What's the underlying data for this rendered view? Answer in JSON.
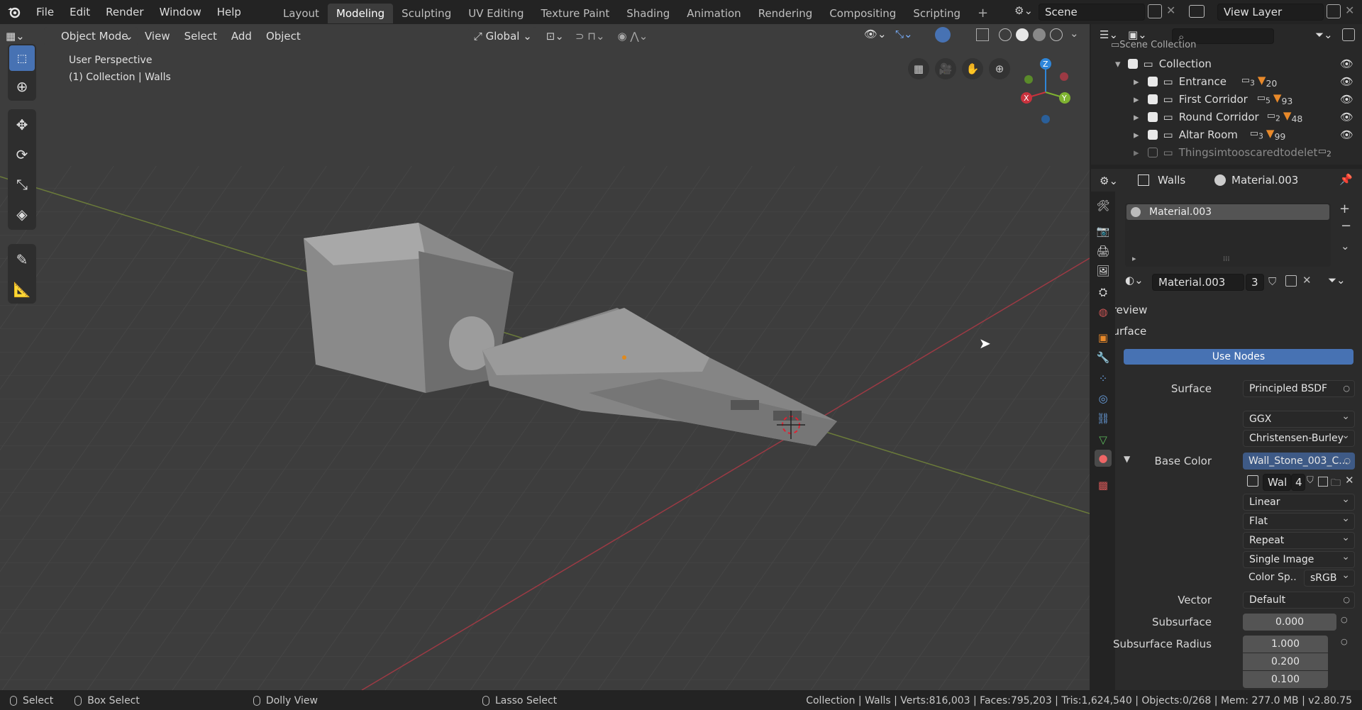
{
  "topbar": {
    "menus": [
      "File",
      "Edit",
      "Render",
      "Window",
      "Help"
    ],
    "workspaces": [
      "Layout",
      "Modeling",
      "Sculpting",
      "UV Editing",
      "Texture Paint",
      "Shading",
      "Animation",
      "Rendering",
      "Compositing",
      "Scripting"
    ],
    "active_workspace": "Modeling",
    "add_tab": "+",
    "scene": "Scene",
    "view_layer": "View Layer"
  },
  "viewport_header": {
    "mode": "Object Mode",
    "menus": [
      "View",
      "Select",
      "Add",
      "Object"
    ],
    "transform_orientation": "Global"
  },
  "viewport": {
    "perspective": "User Perspective",
    "context": "(1) Collection | Walls",
    "gizmo": {
      "x": "X",
      "y": "Y",
      "z": "Z"
    }
  },
  "outliner": {
    "search_placeholder": "",
    "scene_collection": "Scene Collection",
    "collection": "Collection",
    "items": [
      {
        "name": "Entrance",
        "count_a": "3",
        "count_b": "20",
        "enabled": true
      },
      {
        "name": "First Corridor",
        "count_a": "5",
        "count_b": "93",
        "enabled": true
      },
      {
        "name": "Round Corridor",
        "count_a": "2",
        "count_b": "48",
        "enabled": true
      },
      {
        "name": "Altar Room",
        "count_a": "3",
        "count_b": "99",
        "enabled": true
      },
      {
        "name": "Thingsimtooscaredtodelet",
        "count_a": "2",
        "count_b": "",
        "enabled": false
      }
    ]
  },
  "properties": {
    "object": "Walls",
    "material_tab": "Material.003",
    "slot": "Material.003",
    "material_name": "Material.003",
    "users": "3",
    "preview": "Preview",
    "surface_panel": "Surface",
    "use_nodes": "Use Nodes",
    "rows": {
      "surface_label": "Surface",
      "surface_value": "Principled BSDF",
      "distribution": "GGX",
      "subsurface_method": "Christensen-Burley",
      "base_color_label": "Base Color",
      "base_color_value": "Wall_Stone_003_C...",
      "image_name": "Wal",
      "image_users": "4",
      "interpolation": "Linear",
      "projection": "Flat",
      "extension": "Repeat",
      "source": "Single Image",
      "color_space_label": "Color Sp..",
      "color_space_value": "sRGB",
      "vector_label": "Vector",
      "vector_value": "Default",
      "subsurface_label": "Subsurface",
      "subsurface_value": "0.000",
      "radius_label": "Subsurface Radius",
      "radius": [
        "1.000",
        "0.200",
        "0.100"
      ]
    }
  },
  "statusbar": {
    "select": "Select",
    "box_select": "Box Select",
    "dolly": "Dolly View",
    "lasso": "Lasso Select",
    "stats": "Collection | Walls | Verts:816,003 | Faces:795,203 | Tris:1,624,540 | Objects:0/268 | Mem: 277.0 MB | v2.80.75"
  },
  "colors": {
    "accent": "#4772b3",
    "x_axis": "#c8323d",
    "y_axis": "#7fb331",
    "z_axis": "#2f86d9"
  }
}
